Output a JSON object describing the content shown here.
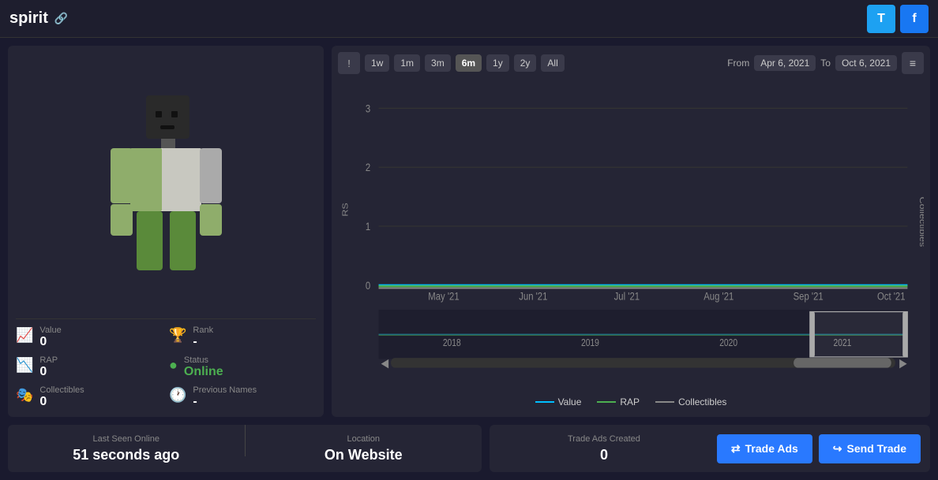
{
  "app": {
    "title": "spirit",
    "link_icon": "🔗"
  },
  "social": {
    "twitter_label": "T",
    "facebook_label": "f"
  },
  "stats": {
    "value_label": "Value",
    "value": "0",
    "rank_label": "Rank",
    "rank": "-",
    "rap_label": "RAP",
    "rap": "0",
    "status_label": "Status",
    "status": "Online",
    "collectibles_label": "Collectibles",
    "collectibles": "0",
    "previous_names_label": "Previous Names",
    "previous_names": "-"
  },
  "chart": {
    "info_btn": "!",
    "time_buttons": [
      "1w",
      "1m",
      "3m",
      "6m",
      "1y",
      "2y",
      "All"
    ],
    "active_time": "6m",
    "from_label": "From",
    "from_date": "Apr 6, 2021",
    "to_label": "To",
    "to_date": "Oct 6, 2021",
    "menu_icon": "≡",
    "y_axis": [
      "3",
      "2",
      "1",
      "0"
    ],
    "y_label": "RS",
    "x_axis_main": [
      "May '21",
      "Jun '21",
      "Jul '21",
      "Aug '21",
      "Sep '21",
      "Oct '21"
    ],
    "x_axis_nav": [
      "2018",
      "2019",
      "2020",
      "2021"
    ],
    "legend": {
      "value_label": "Value",
      "rap_label": "RAP",
      "collectibles_label": "Collectibles"
    },
    "right_label": "Collectibles"
  },
  "bottom": {
    "last_seen_label": "Last Seen Online",
    "last_seen_value": "51 seconds ago",
    "location_label": "Location",
    "location_value": "On Website",
    "trade_ads_label": "Trade Ads Created",
    "trade_ads_value": "0",
    "trade_ads_btn": "Trade Ads",
    "send_trade_btn": "Send Trade"
  }
}
